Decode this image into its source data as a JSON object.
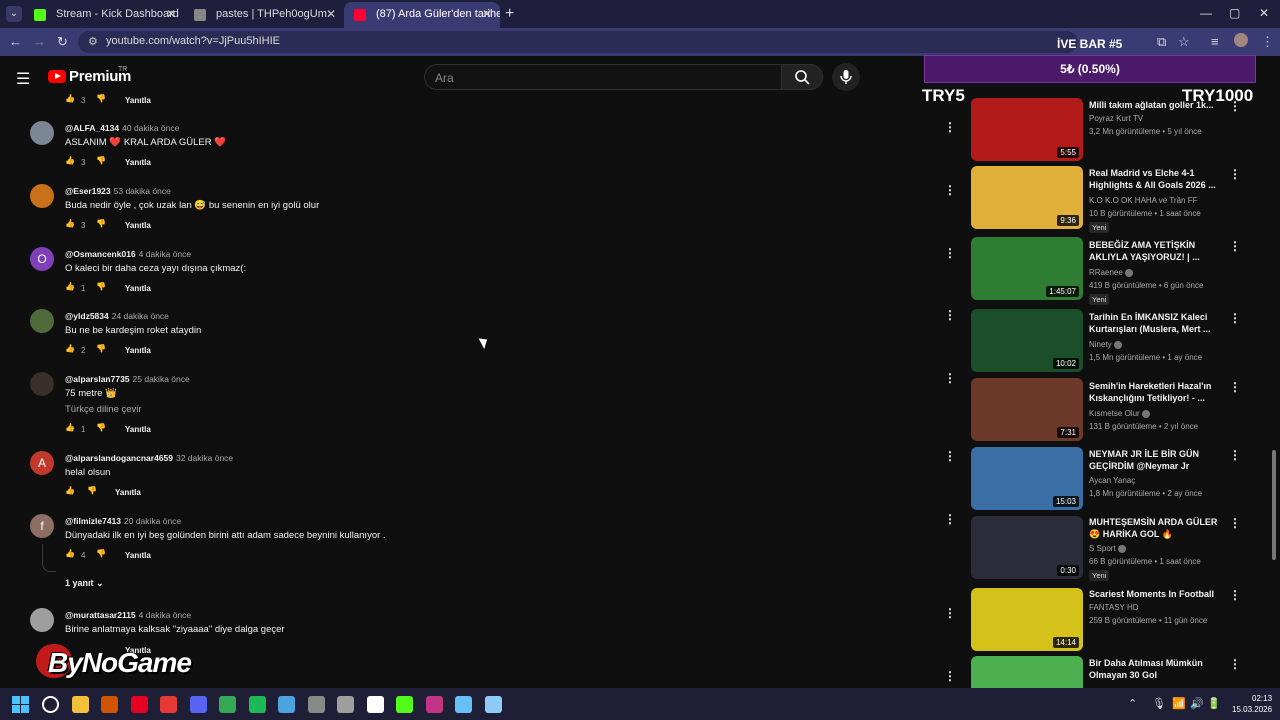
{
  "browser": {
    "tabs": [
      {
        "title": "Stream - Kick Dashboard",
        "color": "#53fc18"
      },
      {
        "title": "pastes | THPeh0ogUm",
        "color": "#888888"
      },
      {
        "title": "(87) Arda Güler'den tarihe geçe",
        "color": "#ff0033"
      }
    ],
    "new_tab": "+",
    "url": "youtube.com/watch?v=JjPuu5hIHIE",
    "window_controls": [
      "—",
      "▢",
      "✕"
    ]
  },
  "youtube": {
    "brand": "Premium",
    "region": "TR",
    "search_placeholder": "Ara"
  },
  "comments": [
    {
      "handle": "",
      "time": "",
      "text": "",
      "likes": "3",
      "reply_label": "Yanıtla",
      "avatar_color": "#555555",
      "avatar_letter": "",
      "only_actions": true
    },
    {
      "handle": "@ALFA_4134",
      "time": "40 dakika önce",
      "text": "ASLANIM ❤️ KRAL ARDA GÜLER ❤️",
      "likes": "3",
      "reply_label": "Yanıtla",
      "avatar_color": "#7b8794",
      "avatar_letter": ""
    },
    {
      "handle": "@Eser1923",
      "time": "53 dakika önce",
      "text": "Buda nedir öyle , çok uzak lan 😅 bu senenin en iyi golü olur",
      "likes": "3",
      "reply_label": "Yanıtla",
      "avatar_color": "#c8701a",
      "avatar_letter": ""
    },
    {
      "handle": "@Osmancenk016",
      "time": "4 dakika önce",
      "text": "O kaleci bir daha ceza yayı dışına çıkmaz(:",
      "likes": "1",
      "reply_label": "Yanıtla",
      "avatar_color": "#7e3fb8",
      "avatar_letter": "O"
    },
    {
      "handle": "@yldz5834",
      "time": "24 dakika önce",
      "text": "Bu ne be kardeşim roket ataydin",
      "likes": "2",
      "reply_label": "Yanıtla",
      "avatar_color": "#4f6b3a",
      "avatar_letter": ""
    },
    {
      "handle": "@alparslan7735",
      "time": "25 dakika önce",
      "text": "75 metre 👑",
      "translate": "Türkçe diline çevir",
      "likes": "1",
      "reply_label": "Yanıtla",
      "avatar_color": "#3a2f2a",
      "avatar_letter": ""
    },
    {
      "handle": "@alparslandogancnar4659",
      "time": "32 dakika önce",
      "text": "helal olsun",
      "likes": "",
      "reply_label": "Yanıtla",
      "avatar_color": "#c0392b",
      "avatar_letter": "A"
    },
    {
      "handle": "@filmizle7413",
      "time": "20 dakika önce",
      "text": "Dünyadaki ilk en iyi beş golünden birini attı adam sadece beynini kullanıyor .",
      "likes": "4",
      "reply_label": "Yanıtla",
      "avatar_color": "#8d6e63",
      "avatar_letter": "f"
    },
    {
      "handle": "@murattasar2115",
      "time": "4 dakika önce",
      "text": "Birine anlatmaya kalksak \"ziyaaaa\" diye dalga geçer",
      "likes": "",
      "reply_label": "Yanıtla",
      "avatar_color": "#9e9e9e",
      "avatar_letter": ""
    }
  ],
  "replies_toggle": "1 yanıt",
  "overlay": {
    "title": "İVE BAR #5",
    "bar_text": "5₺ (0.50%)",
    "left_label": "TRY5",
    "right_label": "TRY1000",
    "watermark": "ByNoGame"
  },
  "videos": [
    {
      "title": "Milli takım ağlatan goller 1k...",
      "channel": "Poyraz Kurt TV",
      "verified": false,
      "stats": "3,2 Mn görüntüleme • 5 yıl önce",
      "duration": "5:55",
      "badge": "",
      "thumb": "#b31b1b"
    },
    {
      "title": "Real Madrid vs Elche 4-1 Highlights & All Goals 2026 ...",
      "channel": "K.O K.O OK HAHA ve Trần FF",
      "verified": false,
      "stats": "10 B görüntüleme • 1 saat önce",
      "duration": "9:36",
      "badge": "Yeni",
      "thumb": "#e0b03a"
    },
    {
      "title": "BEBEĞİZ AMA YETİŞKİN AKLIYLA YAŞIYORUZ! | ...",
      "channel": "RRaenee",
      "verified": true,
      "stats": "419 B görüntüleme • 6 gün önce",
      "duration": "1:45:07",
      "badge": "Yeni",
      "thumb": "#2e7d32"
    },
    {
      "title": "Tarihin En İMKANSIZ Kaleci Kurtarışları (Muslera, Mert ...",
      "channel": "Ninety",
      "verified": true,
      "stats": "1,5 Mn görüntüleme • 1 ay önce",
      "duration": "10:02",
      "badge": "",
      "thumb": "#1b4f2a"
    },
    {
      "title": "Semih'in Hareketleri Hazal'ın Kıskançlığını Tetikliyor! - ...",
      "channel": "Kısmetse Olur",
      "verified": true,
      "stats": "131 B görüntüleme • 2 yıl önce",
      "duration": "7:31",
      "badge": "",
      "thumb": "#6d3a2a"
    },
    {
      "title": "NEYMAR JR İLE BİR GÜN GEÇİRDİM @Neymar Jr",
      "channel": "Aycan Yanaç",
      "verified": false,
      "stats": "1,8 Mn görüntüleme • 2 ay önce",
      "duration": "15:03",
      "badge": "",
      "thumb": "#3a6ea5"
    },
    {
      "title": "MUHTEŞEMSİN ARDA GÜLER 😍 HARİKA GOL 🔥",
      "channel": "S Sport",
      "verified": true,
      "stats": "66 B görüntüleme • 1 saat önce",
      "duration": "0:30",
      "badge": "Yeni",
      "thumb": "#2b2b3a"
    },
    {
      "title": "Scariest Moments In Football",
      "channel": "FANTASY HD",
      "verified": false,
      "stats": "259 B görüntüleme • 11 gün önce",
      "duration": "14:14",
      "badge": "",
      "thumb": "#d4c21a"
    },
    {
      "title": "Bir Daha Atılması Mümkün Olmayan 30 Gol",
      "channel": "",
      "verified": false,
      "stats": "",
      "duration": "",
      "badge": "",
      "thumb": "#4caf50"
    }
  ],
  "taskbar": {
    "apps": [
      {
        "name": "search-icon",
        "color": "#ffffff"
      },
      {
        "name": "file-explorer-icon",
        "color": "#f3c03c"
      },
      {
        "name": "deezer-icon",
        "color": "#d35400"
      },
      {
        "name": "opera-icon",
        "color": "#e60023"
      },
      {
        "name": "app-icon",
        "color": "#e53935"
      },
      {
        "name": "discord-icon",
        "color": "#5865f2"
      },
      {
        "name": "chrome-icon",
        "color": "#34a853"
      },
      {
        "name": "spotify-icon",
        "color": "#1db954"
      },
      {
        "name": "photos-icon",
        "color": "#4aa3df"
      },
      {
        "name": "app-icon",
        "color": "#888888"
      },
      {
        "name": "settings-icon",
        "color": "#9e9e9e"
      },
      {
        "name": "kick-icon",
        "color": "#ffffff"
      },
      {
        "name": "app-icon",
        "color": "#53fc18"
      },
      {
        "name": "instagram-icon",
        "color": "#c13584"
      },
      {
        "name": "steam-icon",
        "color": "#66c0f4"
      },
      {
        "name": "app-icon",
        "color": "#90caf9"
      }
    ],
    "time": "02:13",
    "date": "15.03.2026"
  }
}
